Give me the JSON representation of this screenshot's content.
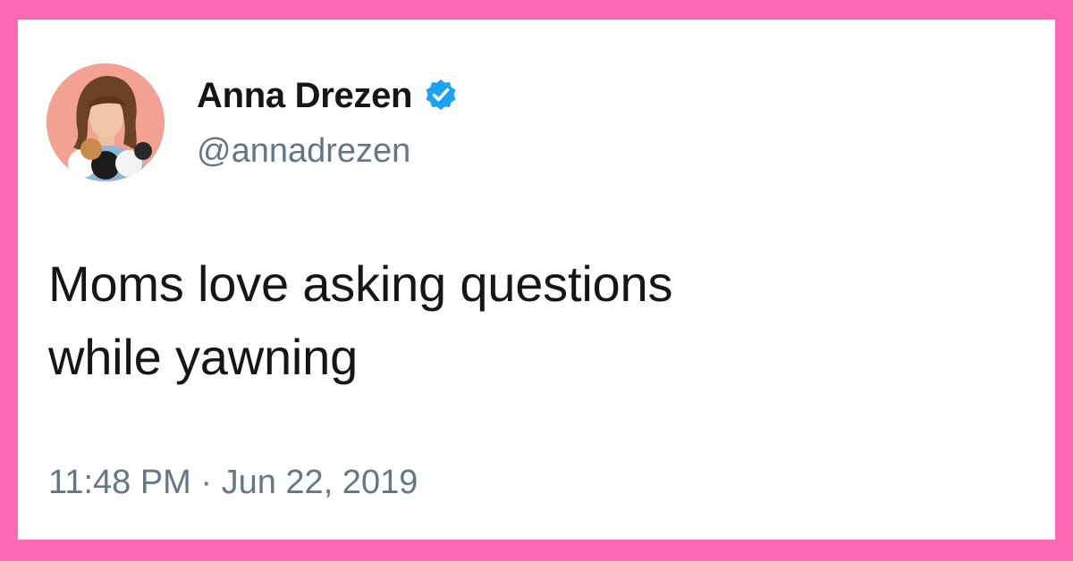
{
  "colors": {
    "frame": "#ff69b4",
    "card": "#ffffff",
    "text_primary": "#14171a",
    "text_secondary": "#657786",
    "verified_blue": "#1da1f2"
  },
  "tweet": {
    "author": {
      "display_name": "Anna Drezen",
      "handle": "@annadrezen",
      "verified": true,
      "avatar_icon": "profile-photo"
    },
    "text_line_1": "Moms love asking questions",
    "text_line_2": "while yawning",
    "timestamp": "11:48 PM · Jun 22, 2019"
  }
}
